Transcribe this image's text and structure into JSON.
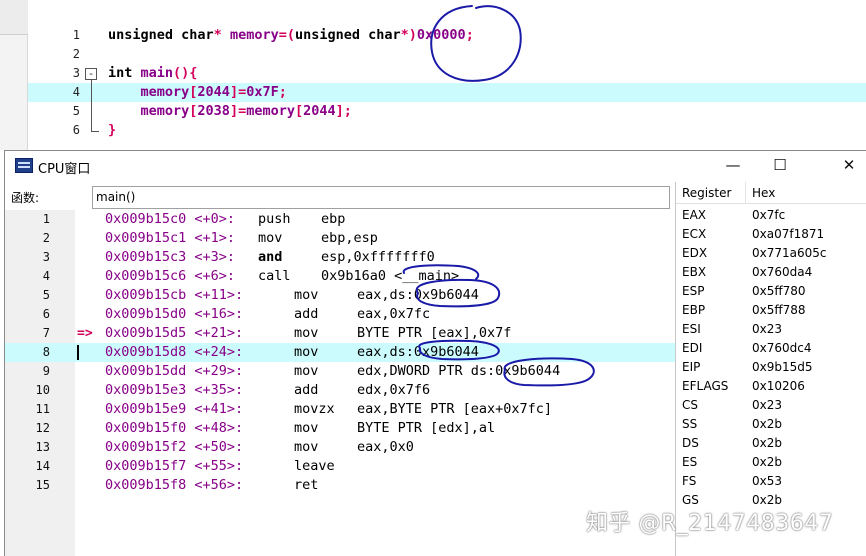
{
  "editor": {
    "lines": [
      {
        "num": "1",
        "parts": [
          {
            "t": "unsigned char",
            "c": "kw"
          },
          {
            "t": "* ",
            "c": "op"
          },
          {
            "t": "memory",
            "c": "id"
          },
          {
            "t": "=(",
            "c": "op"
          },
          {
            "t": "unsigned char",
            "c": "kw"
          },
          {
            "t": "*)",
            "c": "op"
          },
          {
            "t": "0x0000",
            "c": "num"
          },
          {
            "t": ";",
            "c": "op"
          }
        ]
      },
      {
        "num": "2",
        "parts": []
      },
      {
        "num": "3",
        "parts": [
          {
            "t": "int ",
            "c": "kw"
          },
          {
            "t": "main",
            "c": "id"
          },
          {
            "t": "(){",
            "c": "op"
          }
        ]
      },
      {
        "num": "4",
        "parts": [
          {
            "t": "    memory",
            "c": "id"
          },
          {
            "t": "[",
            "c": "op"
          },
          {
            "t": "2044",
            "c": "num"
          },
          {
            "t": "]=",
            "c": "op"
          },
          {
            "t": "0x7F",
            "c": "num"
          },
          {
            "t": ";",
            "c": "op"
          }
        ]
      },
      {
        "num": "5",
        "parts": [
          {
            "t": "    memory",
            "c": "id"
          },
          {
            "t": "[",
            "c": "op"
          },
          {
            "t": "2038",
            "c": "num"
          },
          {
            "t": "]=",
            "c": "op"
          },
          {
            "t": "memory",
            "c": "id"
          },
          {
            "t": "[",
            "c": "op"
          },
          {
            "t": "2044",
            "c": "num"
          },
          {
            "t": "];",
            "c": "op"
          }
        ]
      },
      {
        "num": "6",
        "parts": [
          {
            "t": "}",
            "c": "op"
          }
        ]
      }
    ],
    "highlight_line": 4,
    "fold_symbol": "-"
  },
  "cpu_window": {
    "title": "CPU窗口",
    "buttons": {
      "minimize": "—",
      "maximize": "☐",
      "close": "✕"
    },
    "func_label": "函数:",
    "func_value": "main()",
    "current_marker": "=>",
    "disasm": [
      {
        "num": "1",
        "addr": "0x009b15c0 <+0>:",
        "mn": "push",
        "op": "ebp",
        "bold": false,
        "indent": false
      },
      {
        "num": "2",
        "addr": "0x009b15c1 <+1>:",
        "mn": "mov",
        "op": "ebp,esp",
        "bold": false,
        "indent": false
      },
      {
        "num": "3",
        "addr": "0x009b15c3 <+3>:",
        "mn": "and",
        "op": "esp,0xfffffff0",
        "bold": true,
        "indent": false
      },
      {
        "num": "4",
        "addr": "0x009b15c6 <+6>:",
        "mn": "call",
        "op": "0x9b16a0 <__main>",
        "bold": false,
        "indent": false
      },
      {
        "num": "5",
        "addr": "0x009b15cb <+11>:",
        "mn": "mov",
        "op": "eax,ds:0x9b6044",
        "bold": false,
        "indent": true
      },
      {
        "num": "6",
        "addr": "0x009b15d0 <+16>:",
        "mn": "add",
        "op": "eax,0x7fc",
        "bold": false,
        "indent": true
      },
      {
        "num": "7",
        "addr": "0x009b15d5 <+21>:",
        "mn": "mov",
        "op": "BYTE PTR [eax],0x7f",
        "bold": false,
        "indent": true
      },
      {
        "num": "8",
        "addr": "0x009b15d8 <+24>:",
        "mn": "mov",
        "op": "eax,ds:0x9b6044",
        "bold": false,
        "indent": true
      },
      {
        "num": "9",
        "addr": "0x009b15dd <+29>:",
        "mn": "mov",
        "op": "edx,DWORD PTR ds:0x9b6044",
        "bold": false,
        "indent": true
      },
      {
        "num": "10",
        "addr": "0x009b15e3 <+35>:",
        "mn": "add",
        "op": "edx,0x7f6",
        "bold": false,
        "indent": true
      },
      {
        "num": "11",
        "addr": "0x009b15e9 <+41>:",
        "mn": "movzx",
        "op": "eax,BYTE PTR [eax+0x7fc]",
        "bold": false,
        "indent": true
      },
      {
        "num": "12",
        "addr": "0x009b15f0 <+48>:",
        "mn": "mov",
        "op": "BYTE PTR [edx],al",
        "bold": false,
        "indent": true
      },
      {
        "num": "13",
        "addr": "0x009b15f2 <+50>:",
        "mn": "mov",
        "op": "eax,0x0",
        "bold": false,
        "indent": true
      },
      {
        "num": "14",
        "addr": "0x009b15f7 <+55>:",
        "mn": "leave",
        "op": "",
        "bold": false,
        "indent": true
      },
      {
        "num": "15",
        "addr": "0x009b15f8 <+56>:",
        "mn": "ret",
        "op": "",
        "bold": false,
        "indent": true
      }
    ],
    "current_line": 7,
    "highlight_line": 8,
    "registers": {
      "header": [
        "Register",
        "Hex"
      ],
      "rows": [
        [
          "EAX",
          "0x7fc"
        ],
        [
          "ECX",
          "0xa07f1871"
        ],
        [
          "EDX",
          "0x771a605c"
        ],
        [
          "EBX",
          "0x760da4"
        ],
        [
          "ESP",
          "0x5ff780"
        ],
        [
          "EBP",
          "0x5ff788"
        ],
        [
          "ESI",
          "0x23"
        ],
        [
          "EDI",
          "0x760dc4"
        ],
        [
          "EIP",
          "0x9b15d5"
        ],
        [
          "EFLAGS",
          "0x10206"
        ],
        [
          "CS",
          "0x23"
        ],
        [
          "SS",
          "0x2b"
        ],
        [
          "DS",
          "0x2b"
        ],
        [
          "ES",
          "0x2b"
        ],
        [
          "FS",
          "0x53"
        ],
        [
          "GS",
          "0x2b"
        ]
      ]
    }
  },
  "watermark": "知乎 @R_2147483647",
  "colors": {
    "highlight": "#ccfbfd",
    "address": "#880088",
    "marker": "#d2005a",
    "annotation": "#1a1aa8"
  }
}
